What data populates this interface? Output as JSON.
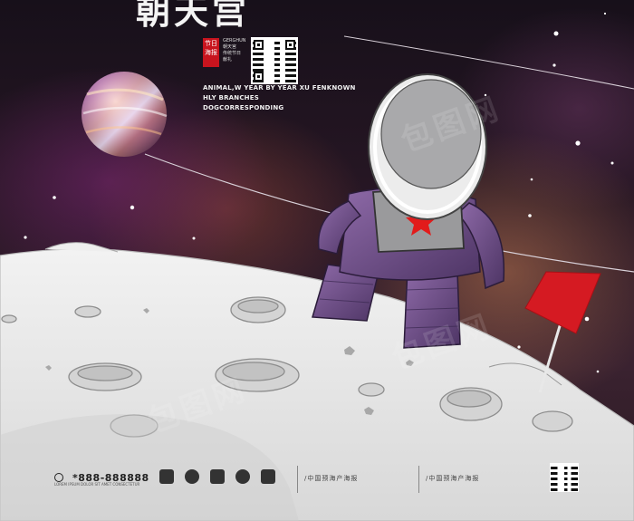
{
  "poster": {
    "title": "朝天宫",
    "seal": {
      "text": "节日海报",
      "side_text": "GERGHUN 朝天宫 传统节日 献礼"
    },
    "tagline": [
      "ANIMAL,W YEAR BY YEAR XU FENKNOWN",
      "HLY BRANCHES",
      "DOGCORRESPONDING"
    ],
    "footer": {
      "phone": "*888-888888",
      "phone_sub": "LOREM IPSUM DOLOR SIT AMET CONSECTETUR",
      "copyright_1": "/中国预海产海报",
      "copyright_2": "/中国预海产海报"
    },
    "watermark": "包图网",
    "colors": {
      "flag": "#d51a22",
      "suit": "#6e4f86",
      "moon": "#e6e6e6",
      "star_badge": "#e21b1b"
    },
    "icons": [
      "planet-icon",
      "star-icon",
      "flag-icon",
      "astronaut-icon",
      "qr-code-icon",
      "phone-icon"
    ]
  }
}
